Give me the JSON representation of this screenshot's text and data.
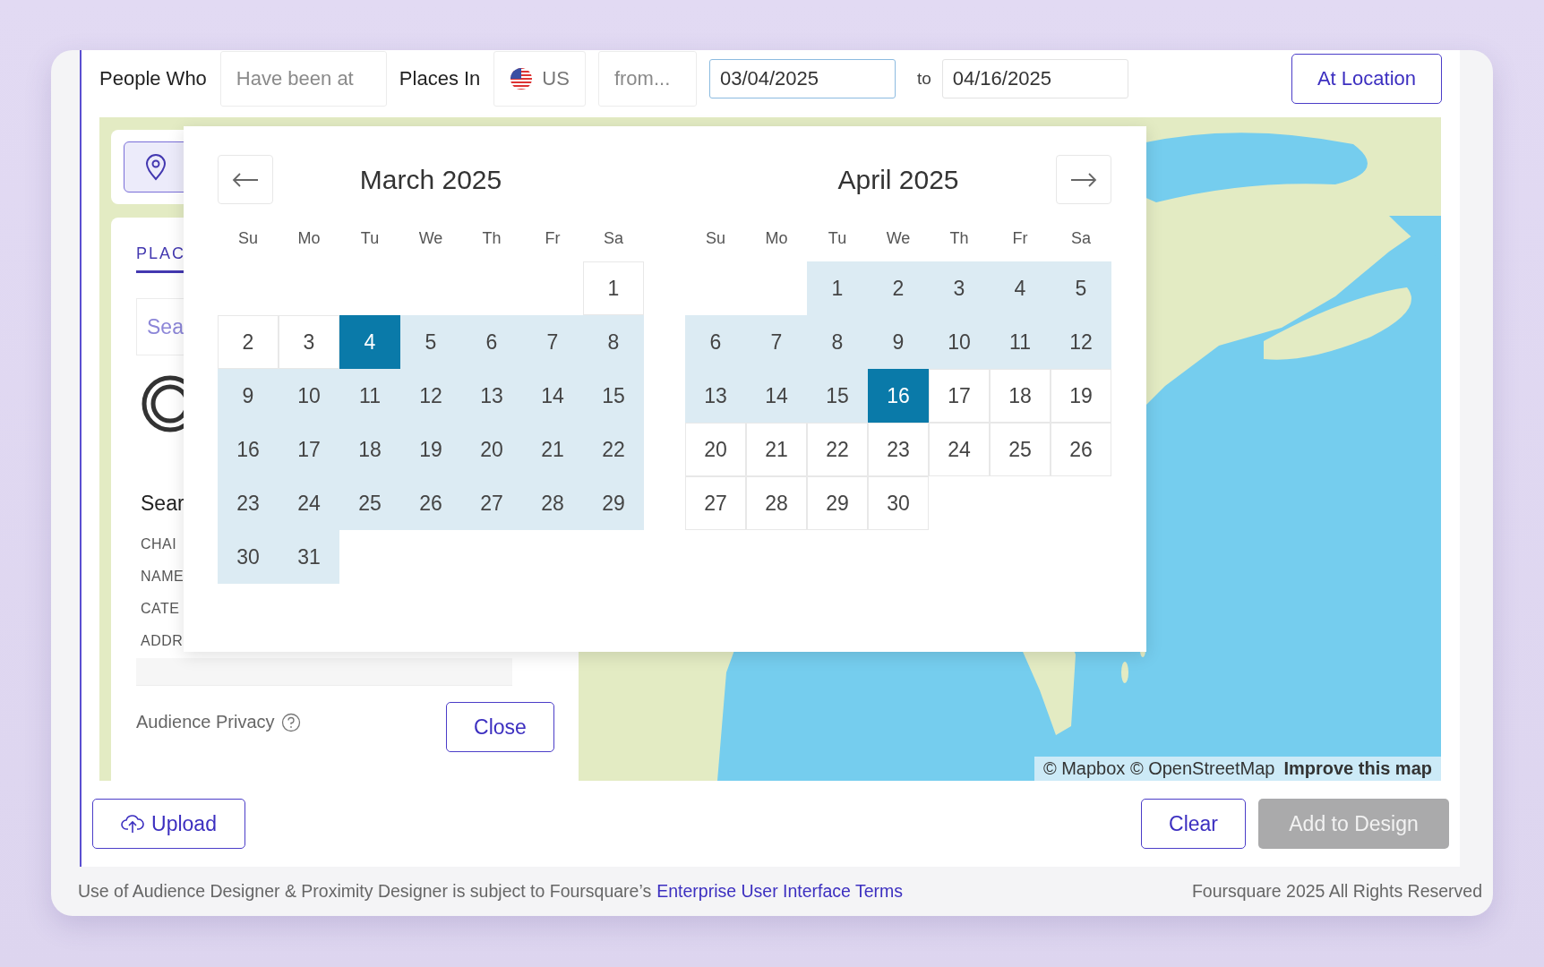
{
  "filter_bar": {
    "label_people": "People Who",
    "action": {
      "placeholder": "Have been at"
    },
    "label_places": "Places In",
    "country": {
      "value": "US"
    },
    "range_type": {
      "placeholder": "from..."
    },
    "start_date": {
      "value": "03/04/2025",
      "focused": true
    },
    "separator": "to",
    "end_date": {
      "value": "04/16/2025",
      "focused": false
    },
    "at_location_button": "At Location"
  },
  "side_panel": {
    "tab": "PLAC",
    "search": {
      "placeholder": "Sea"
    },
    "heading": "Sear",
    "fields": [
      "CHAI",
      "NAME",
      "CATE",
      "ADDR"
    ],
    "privacy_label": "Audience Privacy",
    "close_button": "Close"
  },
  "calendar": {
    "months": [
      {
        "title": "March 2025",
        "weekdays": [
          "Su",
          "Mo",
          "Tu",
          "We",
          "Th",
          "Fr",
          "Sa"
        ],
        "days": [
          {
            "kind": "blank"
          },
          {
            "kind": "blank"
          },
          {
            "kind": "blank"
          },
          {
            "kind": "blank"
          },
          {
            "kind": "blank"
          },
          {
            "kind": "blank"
          },
          {
            "kind": "day",
            "label": "1",
            "selected": false,
            "in_range": false
          },
          {
            "kind": "day",
            "label": "2",
            "selected": false,
            "in_range": false
          },
          {
            "kind": "day",
            "label": "3",
            "selected": false,
            "in_range": false
          },
          {
            "kind": "day",
            "label": "4",
            "selected": true,
            "in_range": true
          },
          {
            "kind": "day",
            "label": "5",
            "selected": false,
            "in_range": true
          },
          {
            "kind": "day",
            "label": "6",
            "selected": false,
            "in_range": true
          },
          {
            "kind": "day",
            "label": "7",
            "selected": false,
            "in_range": true
          },
          {
            "kind": "day",
            "label": "8",
            "selected": false,
            "in_range": true
          },
          {
            "kind": "day",
            "label": "9",
            "selected": false,
            "in_range": true
          },
          {
            "kind": "day",
            "label": "10",
            "selected": false,
            "in_range": true
          },
          {
            "kind": "day",
            "label": "11",
            "selected": false,
            "in_range": true
          },
          {
            "kind": "day",
            "label": "12",
            "selected": false,
            "in_range": true
          },
          {
            "kind": "day",
            "label": "13",
            "selected": false,
            "in_range": true
          },
          {
            "kind": "day",
            "label": "14",
            "selected": false,
            "in_range": true
          },
          {
            "kind": "day",
            "label": "15",
            "selected": false,
            "in_range": true
          },
          {
            "kind": "day",
            "label": "16",
            "selected": false,
            "in_range": true
          },
          {
            "kind": "day",
            "label": "17",
            "selected": false,
            "in_range": true
          },
          {
            "kind": "day",
            "label": "18",
            "selected": false,
            "in_range": true
          },
          {
            "kind": "day",
            "label": "19",
            "selected": false,
            "in_range": true
          },
          {
            "kind": "day",
            "label": "20",
            "selected": false,
            "in_range": true
          },
          {
            "kind": "day",
            "label": "21",
            "selected": false,
            "in_range": true
          },
          {
            "kind": "day",
            "label": "22",
            "selected": false,
            "in_range": true
          },
          {
            "kind": "day",
            "label": "23",
            "selected": false,
            "in_range": true
          },
          {
            "kind": "day",
            "label": "24",
            "selected": false,
            "in_range": true
          },
          {
            "kind": "day",
            "label": "25",
            "selected": false,
            "in_range": true
          },
          {
            "kind": "day",
            "label": "26",
            "selected": false,
            "in_range": true
          },
          {
            "kind": "day",
            "label": "27",
            "selected": false,
            "in_range": true
          },
          {
            "kind": "day",
            "label": "28",
            "selected": false,
            "in_range": true
          },
          {
            "kind": "day",
            "label": "29",
            "selected": false,
            "in_range": true
          },
          {
            "kind": "day",
            "label": "30",
            "selected": false,
            "in_range": true
          },
          {
            "kind": "day",
            "label": "31",
            "selected": false,
            "in_range": true
          }
        ]
      },
      {
        "title": "April 2025",
        "weekdays": [
          "Su",
          "Mo",
          "Tu",
          "We",
          "Th",
          "Fr",
          "Sa"
        ],
        "days": [
          {
            "kind": "blank"
          },
          {
            "kind": "blank"
          },
          {
            "kind": "day",
            "label": "1",
            "selected": false,
            "in_range": true
          },
          {
            "kind": "day",
            "label": "2",
            "selected": false,
            "in_range": true
          },
          {
            "kind": "day",
            "label": "3",
            "selected": false,
            "in_range": true
          },
          {
            "kind": "day",
            "label": "4",
            "selected": false,
            "in_range": true
          },
          {
            "kind": "day",
            "label": "5",
            "selected": false,
            "in_range": true
          },
          {
            "kind": "day",
            "label": "6",
            "selected": false,
            "in_range": true
          },
          {
            "kind": "day",
            "label": "7",
            "selected": false,
            "in_range": true
          },
          {
            "kind": "day",
            "label": "8",
            "selected": false,
            "in_range": true
          },
          {
            "kind": "day",
            "label": "9",
            "selected": false,
            "in_range": true
          },
          {
            "kind": "day",
            "label": "10",
            "selected": false,
            "in_range": true
          },
          {
            "kind": "day",
            "label": "11",
            "selected": false,
            "in_range": true
          },
          {
            "kind": "day",
            "label": "12",
            "selected": false,
            "in_range": true
          },
          {
            "kind": "day",
            "label": "13",
            "selected": false,
            "in_range": true
          },
          {
            "kind": "day",
            "label": "14",
            "selected": false,
            "in_range": true
          },
          {
            "kind": "day",
            "label": "15",
            "selected": false,
            "in_range": true
          },
          {
            "kind": "day",
            "label": "16",
            "selected": true,
            "in_range": true
          },
          {
            "kind": "day",
            "label": "17",
            "selected": false,
            "in_range": false
          },
          {
            "kind": "day",
            "label": "18",
            "selected": false,
            "in_range": false
          },
          {
            "kind": "day",
            "label": "19",
            "selected": false,
            "in_range": false
          },
          {
            "kind": "day",
            "label": "20",
            "selected": false,
            "in_range": false
          },
          {
            "kind": "day",
            "label": "21",
            "selected": false,
            "in_range": false
          },
          {
            "kind": "day",
            "label": "22",
            "selected": false,
            "in_range": false
          },
          {
            "kind": "day",
            "label": "23",
            "selected": false,
            "in_range": false
          },
          {
            "kind": "day",
            "label": "24",
            "selected": false,
            "in_range": false
          },
          {
            "kind": "day",
            "label": "25",
            "selected": false,
            "in_range": false
          },
          {
            "kind": "day",
            "label": "26",
            "selected": false,
            "in_range": false
          },
          {
            "kind": "day",
            "label": "27",
            "selected": false,
            "in_range": false
          },
          {
            "kind": "day",
            "label": "28",
            "selected": false,
            "in_range": false
          },
          {
            "kind": "day",
            "label": "29",
            "selected": false,
            "in_range": false
          },
          {
            "kind": "day",
            "label": "30",
            "selected": false,
            "in_range": false
          }
        ]
      }
    ]
  },
  "map": {
    "kind": "picture",
    "attribution": "© Mapbox © OpenStreetMap",
    "improve_link": "Improve this map"
  },
  "actions": {
    "upload_button": "Upload",
    "clear_button": "Clear",
    "add_button": {
      "label": "Add to Design",
      "disabled": true
    }
  },
  "footer": {
    "notice": "Use of Audience Designer & Proximity Designer is subject to Foursquare’s",
    "terms_link": "Enterprise User Interface Terms",
    "copyright": "Foursquare 2025 All Rights Reserved"
  }
}
